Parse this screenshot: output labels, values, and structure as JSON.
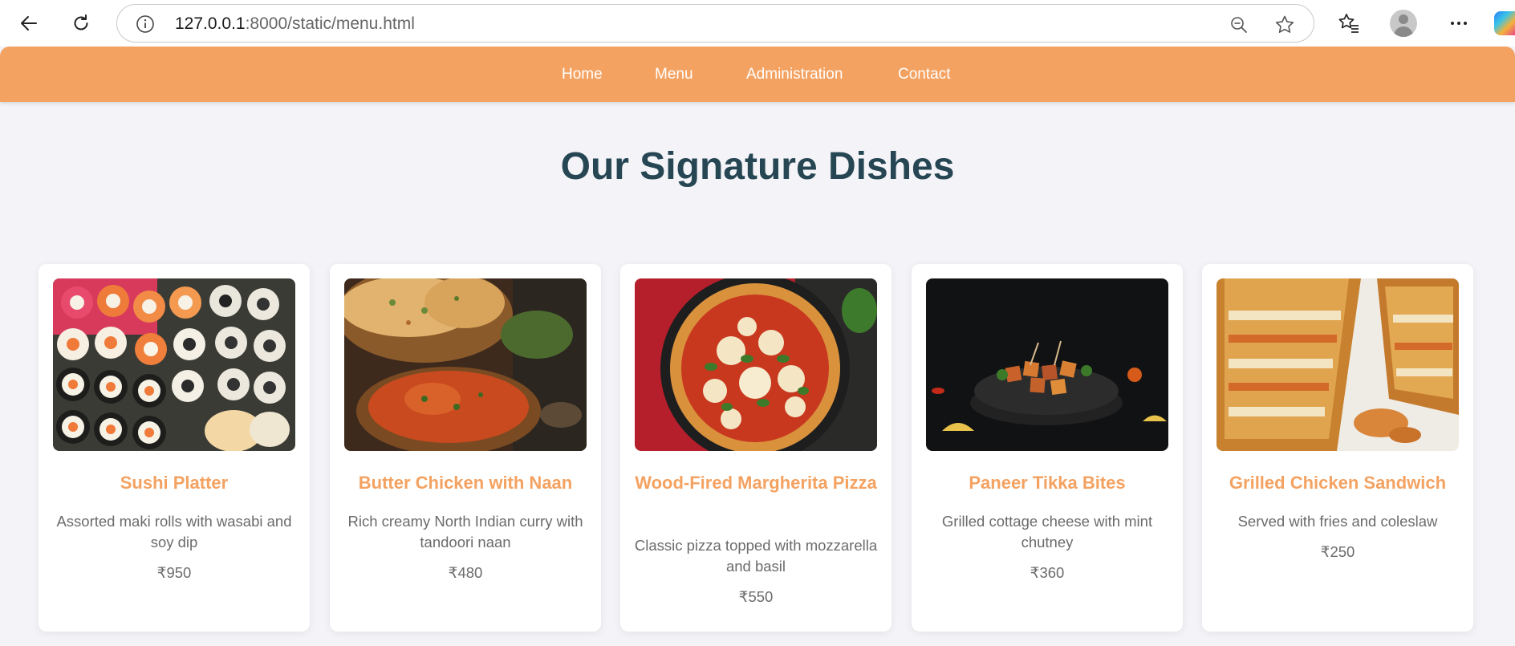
{
  "browser": {
    "url_host": "127.0.0.1",
    "url_path": ":8000/static/menu.html"
  },
  "nav": {
    "items": [
      "Home",
      "Menu",
      "Administration",
      "Contact"
    ]
  },
  "page": {
    "title": "Our Signature Dishes"
  },
  "dishes": [
    {
      "name": "Sushi Platter",
      "description": "Assorted maki rolls with wasabi and soy dip",
      "price": "₹950"
    },
    {
      "name": "Butter Chicken with Naan",
      "description": "Rich creamy North Indian curry with tandoori naan",
      "price": "₹480"
    },
    {
      "name": "Wood-Fired Margherita Pizza",
      "description": "Classic pizza topped with mozzarella and basil",
      "price": "₹550"
    },
    {
      "name": "Paneer Tikka Bites",
      "description": "Grilled cottage cheese with mint chutney",
      "price": "₹360"
    },
    {
      "name": "Grilled Chicken Sandwich",
      "description": "Served with fries and coleslaw",
      "price": "₹250"
    }
  ],
  "colors": {
    "nav_bg": "#f4a261",
    "title": "#264653",
    "dish_name": "#f4a261",
    "page_bg": "#f4f4f8"
  }
}
